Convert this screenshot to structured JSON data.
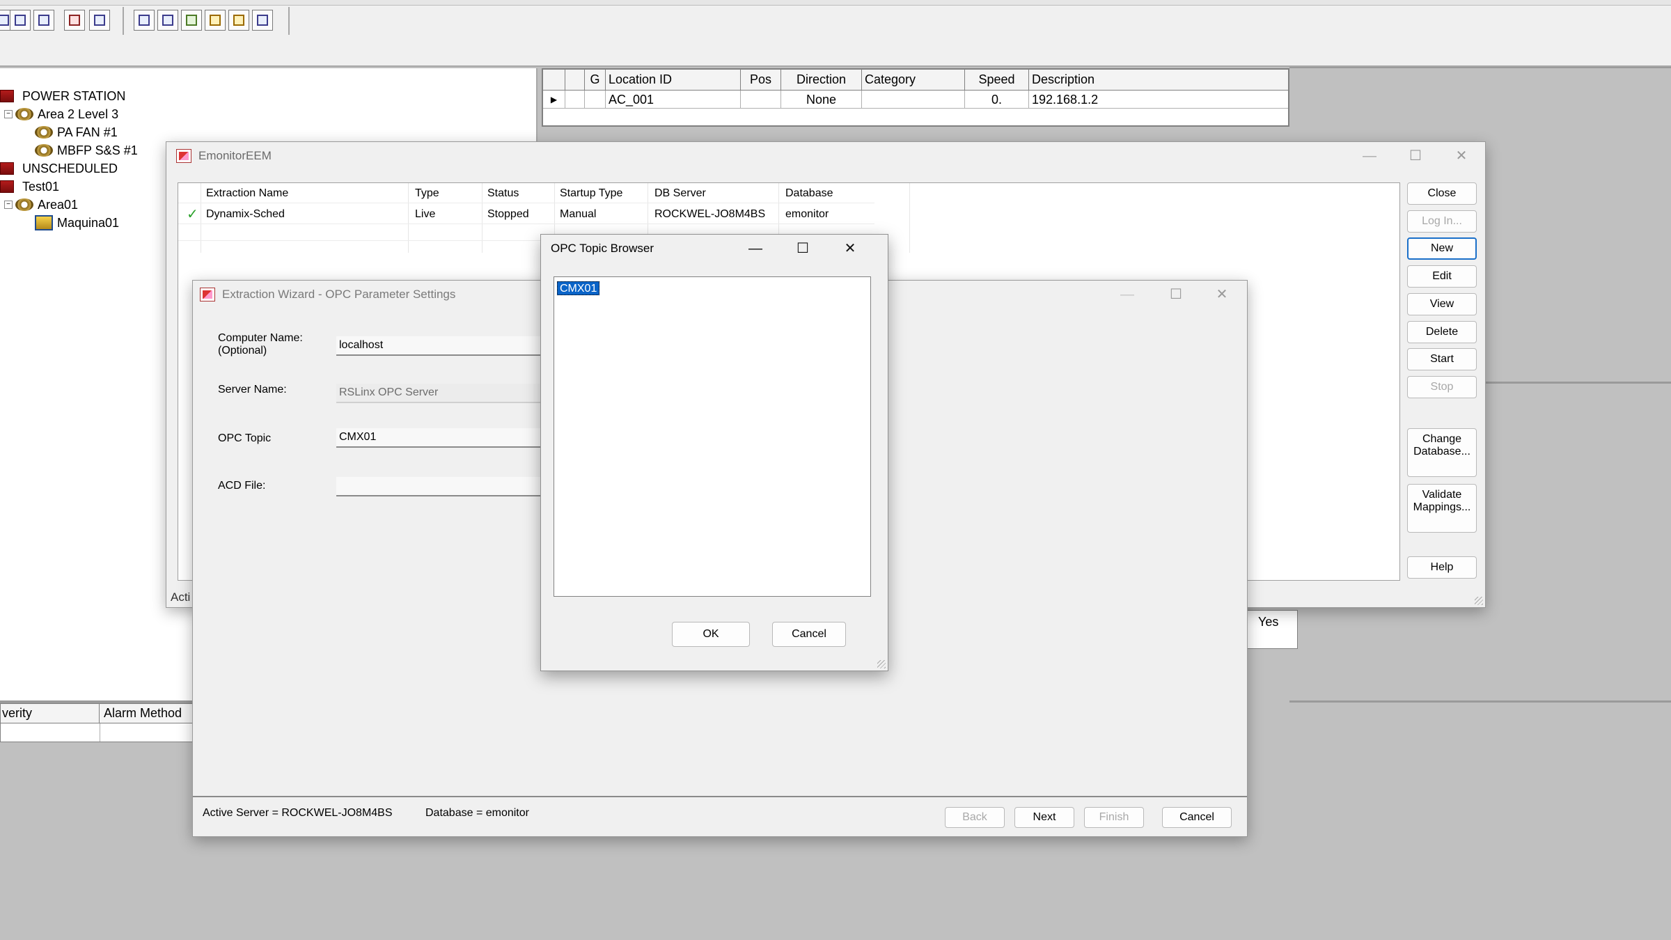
{
  "tree": {
    "items": [
      {
        "label": "POWER STATION",
        "icon": "plant-icon"
      },
      {
        "label": "Area 2 Level 3",
        "icon": "area-icon"
      },
      {
        "label": "PA FAN #1",
        "icon": "machine-icon"
      },
      {
        "label": "MBFP S&S #1",
        "icon": "machine-icon"
      },
      {
        "label": "UNSCHEDULED",
        "icon": "plant-icon"
      },
      {
        "label": "Test01",
        "icon": "plant-icon"
      },
      {
        "label": "Area01",
        "icon": "area-icon"
      },
      {
        "label": "Maquina01",
        "icon": "equipment-icon"
      }
    ]
  },
  "location_grid": {
    "headers": [
      "G",
      "Location ID",
      "Pos",
      "Direction",
      "Category",
      "Speed",
      "Description"
    ],
    "row": {
      "location_id": "AC_001",
      "pos": "",
      "direction": "None",
      "category": "",
      "speed": "0.",
      "description": "192.168.1.2"
    }
  },
  "alarm_grid": {
    "headers": [
      "verity",
      "Alarm Method"
    ]
  },
  "right_bg_cell": "Yes",
  "emonitor": {
    "title": "EmonitorEEM",
    "columns": [
      "Extraction Name",
      "Type",
      "Status",
      "Startup Type",
      "DB Server",
      "Database"
    ],
    "row": {
      "check": "✓",
      "name": "Dynamix-Sched",
      "type": "Live",
      "status": "Stopped",
      "startup": "Manual",
      "db_server": "ROCKWEL-JO8M4BS",
      "database": "emonitor"
    },
    "status_partial": "Acti",
    "buttons": {
      "close": "Close",
      "login": "Log In...",
      "new": "New",
      "edit": "Edit",
      "view": "View",
      "delete": "Delete",
      "start": "Start",
      "stop": "Stop",
      "change_db_1": "Change",
      "change_db_2": "Database...",
      "validate_1": "Validate",
      "validate_2": "Mappings...",
      "help": "Help"
    }
  },
  "wizard": {
    "title": "Extraction Wizard - OPC Parameter Settings",
    "computer_name_label_1": "Computer Name:",
    "computer_name_label_2": "(Optional)",
    "computer_name_value": "localhost",
    "server_name_label": "Server Name:",
    "server_name_value": "RSLinx OPC Server",
    "opc_topic_label": "OPC Topic",
    "opc_topic_value": "CMX01",
    "acd_file_label": "ACD File:",
    "acd_file_value": "",
    "status_server": "Active Server = ROCKWEL-JO8M4BS",
    "status_db": "Database = emonitor",
    "buttons": {
      "back": "Back",
      "next": "Next",
      "finish": "Finish",
      "cancel": "Cancel"
    }
  },
  "opc_browser": {
    "title": "OPC Topic Browser",
    "topics": [
      "CMX01"
    ],
    "ok": "OK",
    "cancel": "Cancel"
  },
  "window_controls": {
    "minimize": "—",
    "maximize": "☐",
    "close": "✕"
  }
}
